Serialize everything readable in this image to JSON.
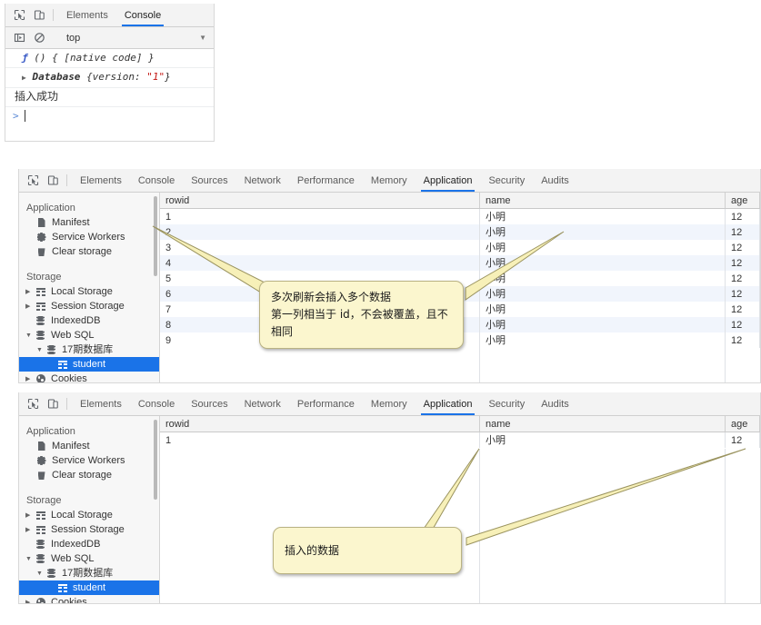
{
  "panels": {
    "console": {
      "toolbar": {
        "inspect_icon": "inspect-element-icon",
        "device_icon": "device-toolbar-icon",
        "tabs": [
          {
            "label": "Elements",
            "active": false
          },
          {
            "label": "Console",
            "active": true
          }
        ]
      },
      "filterbar": {
        "sidebar_icon": "console-sidebar-icon",
        "clear_icon": "clear-console-icon",
        "context": "top",
        "caret": "▼"
      },
      "messages": [
        {
          "type": "code",
          "text": "ƒ () { [native code] }"
        },
        {
          "type": "object",
          "disclosure": "▶",
          "name": "Database",
          "body": "{version: ",
          "value": "\"1\"",
          "close": "}"
        },
        {
          "type": "log",
          "text": "插入成功"
        }
      ],
      "prompt": {
        "arrow": ">",
        "value": ""
      }
    },
    "application_multi": {
      "toolbar": {
        "inspect_icon": "inspect-element-icon",
        "device_icon": "device-toolbar-icon",
        "tabs": [
          {
            "label": "Elements",
            "active": false
          },
          {
            "label": "Console",
            "active": false
          },
          {
            "label": "Sources",
            "active": false
          },
          {
            "label": "Network",
            "active": false
          },
          {
            "label": "Performance",
            "active": false
          },
          {
            "label": "Memory",
            "active": false
          },
          {
            "label": "Application",
            "active": true
          },
          {
            "label": "Security",
            "active": false
          },
          {
            "label": "Audits",
            "active": false
          }
        ]
      },
      "sidebar": {
        "groups": [
          {
            "title": "Application",
            "items": [
              {
                "label": "Manifest",
                "icon": "manifest-doc-icon",
                "indent": 1,
                "twisty": "",
                "selected": false
              },
              {
                "label": "Service Workers",
                "icon": "gear-icon",
                "indent": 1,
                "twisty": "",
                "selected": false
              },
              {
                "label": "Clear storage",
                "icon": "trash-icon",
                "indent": 1,
                "twisty": "",
                "selected": false
              }
            ]
          },
          {
            "title": "Storage",
            "items": [
              {
                "label": "Local Storage",
                "icon": "table-icon",
                "indent": 1,
                "twisty": "▶",
                "selected": false
              },
              {
                "label": "Session Storage",
                "icon": "table-icon",
                "indent": 1,
                "twisty": "▶",
                "selected": false
              },
              {
                "label": "IndexedDB",
                "icon": "database-icon",
                "indent": 1,
                "twisty": "",
                "selected": false
              },
              {
                "label": "Web SQL",
                "icon": "database-icon",
                "indent": 1,
                "twisty": "▼",
                "selected": false
              },
              {
                "label": "17期数据库",
                "icon": "database-icon",
                "indent": 2,
                "twisty": "▼",
                "selected": false
              },
              {
                "label": "student",
                "icon": "table-icon",
                "indent": 3,
                "twisty": "",
                "selected": true
              },
              {
                "label": "Cookies",
                "icon": "cookie-icon",
                "indent": 1,
                "twisty": "▶",
                "selected": false
              }
            ]
          }
        ]
      },
      "grid": {
        "columns": [
          "rowid",
          "name",
          "age"
        ],
        "rows": [
          [
            "1",
            "小明",
            "12"
          ],
          [
            "2",
            "小明",
            "12"
          ],
          [
            "3",
            "小明",
            "12"
          ],
          [
            "4",
            "小明",
            "12"
          ],
          [
            "5",
            "小明",
            "12"
          ],
          [
            "6",
            "小明",
            "12"
          ],
          [
            "7",
            "小明",
            "12"
          ],
          [
            "8",
            "小明",
            "12"
          ],
          [
            "9",
            "小明",
            "12"
          ]
        ]
      },
      "callout": "多次刷新会插入多个数据\n第一列相当于 id，不会被覆盖，且不相同"
    },
    "application_single": {
      "toolbar": {
        "inspect_icon": "inspect-element-icon",
        "device_icon": "device-toolbar-icon",
        "tabs": [
          {
            "label": "Elements",
            "active": false
          },
          {
            "label": "Console",
            "active": false
          },
          {
            "label": "Sources",
            "active": false
          },
          {
            "label": "Network",
            "active": false
          },
          {
            "label": "Performance",
            "active": false
          },
          {
            "label": "Memory",
            "active": false
          },
          {
            "label": "Application",
            "active": true
          },
          {
            "label": "Security",
            "active": false
          },
          {
            "label": "Audits",
            "active": false
          }
        ]
      },
      "sidebar": {
        "groups": [
          {
            "title": "Application",
            "items": [
              {
                "label": "Manifest",
                "icon": "manifest-doc-icon",
                "indent": 1,
                "twisty": "",
                "selected": false
              },
              {
                "label": "Service Workers",
                "icon": "gear-icon",
                "indent": 1,
                "twisty": "",
                "selected": false
              },
              {
                "label": "Clear storage",
                "icon": "trash-icon",
                "indent": 1,
                "twisty": "",
                "selected": false
              }
            ]
          },
          {
            "title": "Storage",
            "items": [
              {
                "label": "Local Storage",
                "icon": "table-icon",
                "indent": 1,
                "twisty": "▶",
                "selected": false
              },
              {
                "label": "Session Storage",
                "icon": "table-icon",
                "indent": 1,
                "twisty": "▶",
                "selected": false
              },
              {
                "label": "IndexedDB",
                "icon": "database-icon",
                "indent": 1,
                "twisty": "",
                "selected": false
              },
              {
                "label": "Web SQL",
                "icon": "database-icon",
                "indent": 1,
                "twisty": "▼",
                "selected": false
              },
              {
                "label": "17期数据库",
                "icon": "database-icon",
                "indent": 2,
                "twisty": "▼",
                "selected": false
              },
              {
                "label": "student",
                "icon": "table-icon",
                "indent": 3,
                "twisty": "",
                "selected": true
              },
              {
                "label": "Cookies",
                "icon": "cookie-icon",
                "indent": 1,
                "twisty": "▶",
                "selected": false
              }
            ]
          }
        ]
      },
      "grid": {
        "columns": [
          "rowid",
          "name",
          "age"
        ],
        "rows": [
          [
            "1",
            "小明",
            "12"
          ]
        ]
      },
      "callout": "插入的数据"
    }
  },
  "colors": {
    "accent": "#1a73e8",
    "callout_bg": "#fbf6ce",
    "callout_border": "#b9b283",
    "row_alt": "#f1f5fc",
    "string_literal": "#c41a16"
  }
}
